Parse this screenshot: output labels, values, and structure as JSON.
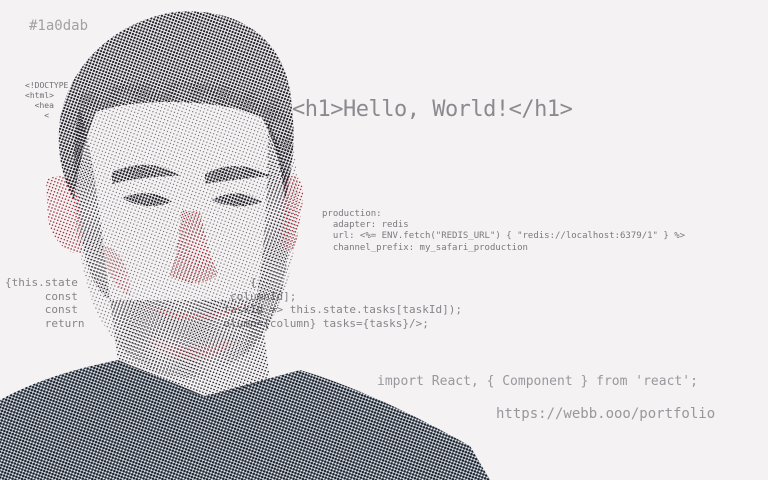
{
  "background": {
    "color": "#f4f2f3"
  },
  "code_fragments": {
    "hex": "#1a0dab",
    "html_lines": [
      "<!DOCTYPE",
      "<html>",
      "  <hea",
      "    <"
    ],
    "h1": "<h1>Hello, World!</h1>",
    "yaml_lines": [
      "production:",
      "  adapter: redis",
      "  url: <%= ENV.fetch(\"REDIS_URL\") { \"redis://localhost:6379/1\" } %>",
      "  channel_prefix: my_safari_production"
    ],
    "js_lines": [
      "{this.state                          {",
      "      const                       columnId];",
      "      const                      taskId => this.state.tasks[taskId]);",
      "      return                     olumn={column} tasks={tasks}/>;"
    ],
    "import": "import React, { Component } from 'react';",
    "url": "https://webb.ooo/portfolio"
  },
  "portrait": {
    "dark_color": "#1b1a22",
    "red_color": "#a12a36",
    "shirt_color": "#15202e"
  }
}
